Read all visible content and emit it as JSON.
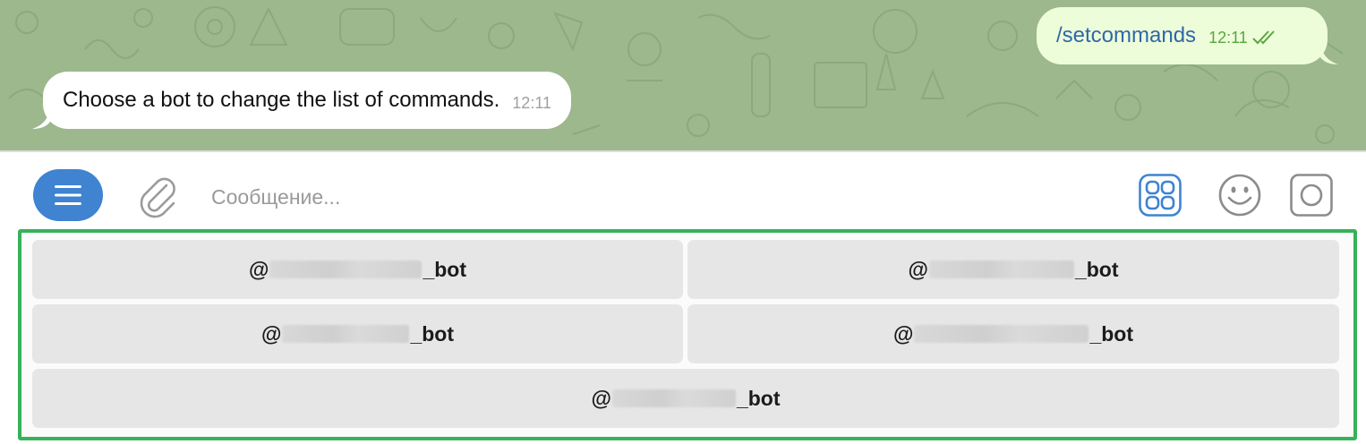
{
  "messages": {
    "incoming": {
      "text": "Choose a bot to change the list of commands.",
      "time": "12:11"
    },
    "outgoing": {
      "text": "/setcommands",
      "time": "12:11",
      "status_icon": "double-check-icon"
    }
  },
  "composer": {
    "menu_icon": "hamburger-menu-icon",
    "attach_icon": "paperclip-icon",
    "placeholder": "Сообщение...",
    "keyboard_icon": "bot-keyboard-icon",
    "emoji_icon": "emoji-icon",
    "record_icon": "record-icon"
  },
  "bot_keyboard": {
    "buttons": [
      {
        "prefix": "@",
        "suffix": "_bot"
      },
      {
        "prefix": "@",
        "suffix": "_bot"
      },
      {
        "prefix": "@",
        "suffix": "_bot"
      },
      {
        "prefix": "@",
        "suffix": "_bot"
      },
      {
        "prefix": "@",
        "suffix": "_bot"
      }
    ]
  },
  "colors": {
    "chat_background": "#9cb88c",
    "outgoing_bubble": "#eefdd9",
    "accent": "#3f83d1",
    "highlight_border": "#36b25a"
  }
}
